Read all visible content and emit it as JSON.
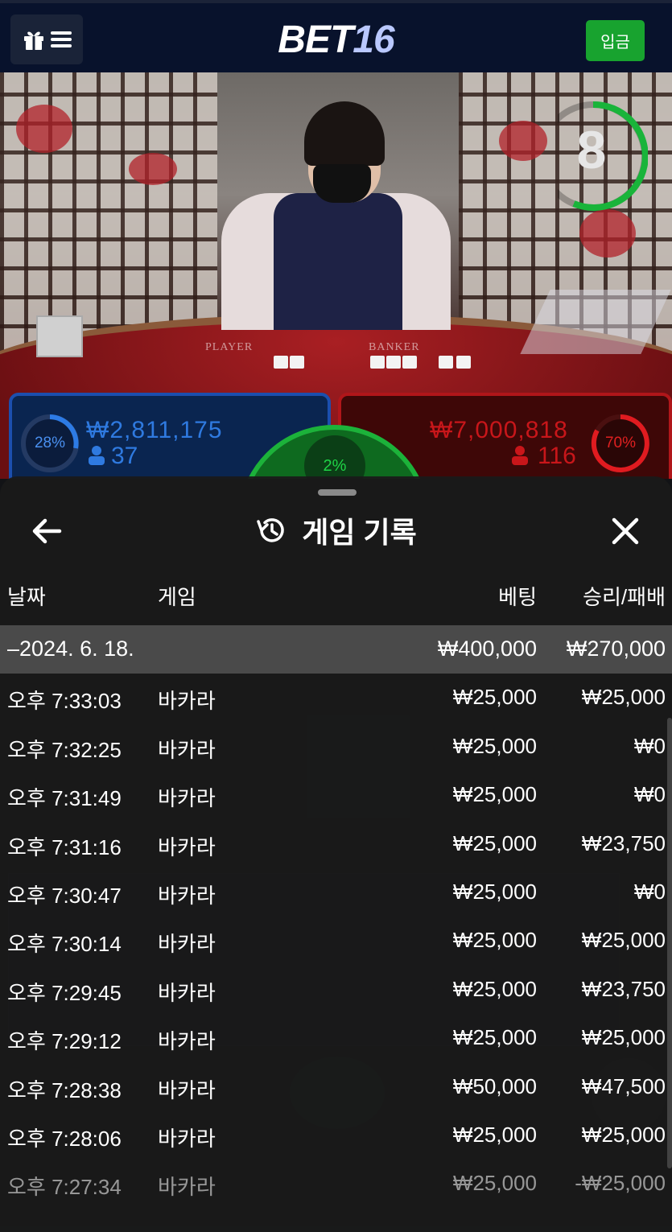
{
  "header": {
    "logo_main": "BET",
    "logo_num": "16",
    "deposit_label": "입금"
  },
  "video": {
    "countdown": "8",
    "table_labels": {
      "player": "PLAYER",
      "banker": "BANKER"
    },
    "player": {
      "percent": "28%",
      "amount": "₩2,811,175",
      "count": "37"
    },
    "banker": {
      "percent": "70%",
      "amount": "₩7,000,818",
      "count": "116"
    },
    "tie": {
      "percent": "2%"
    }
  },
  "modal": {
    "title": "게임 기록",
    "columns": {
      "date": "날짜",
      "game": "게임",
      "bet": "베팅",
      "result": "승리/패배"
    },
    "summary": {
      "date": "–2024. 6. 18.",
      "bet": "₩400,000",
      "result": "₩270,000"
    },
    "rows": [
      {
        "time": "오후 7:33:03",
        "game": "바카라",
        "bet": "₩25,000",
        "result": "₩25,000"
      },
      {
        "time": "오후 7:32:25",
        "game": "바카라",
        "bet": "₩25,000",
        "result": "₩0"
      },
      {
        "time": "오후 7:31:49",
        "game": "바카라",
        "bet": "₩25,000",
        "result": "₩0"
      },
      {
        "time": "오후 7:31:16",
        "game": "바카라",
        "bet": "₩25,000",
        "result": "₩23,750"
      },
      {
        "time": "오후 7:30:47",
        "game": "바카라",
        "bet": "₩25,000",
        "result": "₩0"
      },
      {
        "time": "오후 7:30:14",
        "game": "바카라",
        "bet": "₩25,000",
        "result": "₩25,000"
      },
      {
        "time": "오후 7:29:45",
        "game": "바카라",
        "bet": "₩25,000",
        "result": "₩23,750"
      },
      {
        "time": "오후 7:29:12",
        "game": "바카라",
        "bet": "₩25,000",
        "result": "₩25,000"
      },
      {
        "time": "오후 7:28:38",
        "game": "바카라",
        "bet": "₩50,000",
        "result": "₩47,500"
      },
      {
        "time": "오후 7:28:06",
        "game": "바카라",
        "bet": "₩25,000",
        "result": "₩25,000"
      },
      {
        "time": "오후 7:27:34",
        "game": "바카라",
        "bet": "₩25,000",
        "result": "-₩25,000"
      }
    ]
  },
  "colors": {
    "topbar": "#08122c",
    "deposit": "#18a32f",
    "player": "#1c4fae",
    "banker": "#b0161a",
    "tie": "#1cb23a",
    "summary_row": "#4a4a4a"
  }
}
